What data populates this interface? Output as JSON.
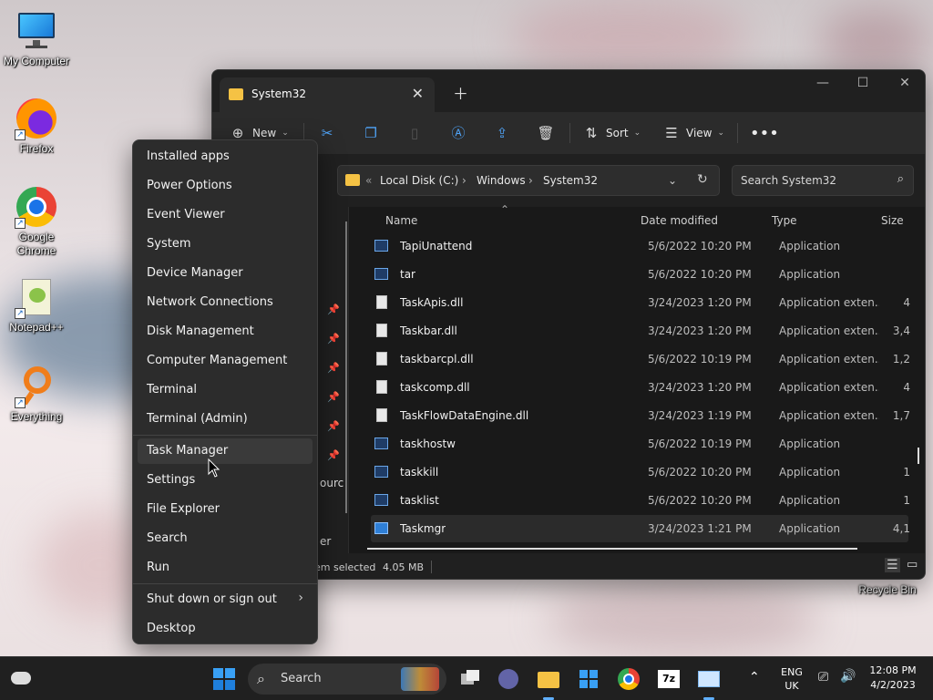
{
  "desktop": {
    "icons": [
      {
        "label": "My Computer"
      },
      {
        "label": "Firefox"
      },
      {
        "label": "Google Chrome"
      },
      {
        "label": "Notepad++"
      },
      {
        "label": "Everything"
      },
      {
        "label": "Recycle Bin"
      }
    ]
  },
  "explorer": {
    "tab_title": "System32",
    "toolbar": {
      "new_label": "New",
      "sort_label": "Sort",
      "view_label": "View"
    },
    "breadcrumb": [
      "Local Disk (C:)",
      "Windows",
      "System32"
    ],
    "search_placeholder": "Search System32",
    "columns": {
      "name": "Name",
      "date": "Date modified",
      "type": "Type",
      "size": "Size"
    },
    "files": [
      {
        "name": "TapiUnattend",
        "date": "5/6/2022 10:20 PM",
        "type": "Application",
        "size": ""
      },
      {
        "name": "tar",
        "date": "5/6/2022 10:20 PM",
        "type": "Application",
        "size": ""
      },
      {
        "name": "TaskApis.dll",
        "date": "3/24/2023 1:20 PM",
        "type": "Application exten...",
        "size": "4"
      },
      {
        "name": "Taskbar.dll",
        "date": "3/24/2023 1:20 PM",
        "type": "Application exten...",
        "size": "3,4"
      },
      {
        "name": "taskbarcpl.dll",
        "date": "5/6/2022 10:19 PM",
        "type": "Application exten...",
        "size": "1,2"
      },
      {
        "name": "taskcomp.dll",
        "date": "3/24/2023 1:20 PM",
        "type": "Application exten...",
        "size": "4"
      },
      {
        "name": "TaskFlowDataEngine.dll",
        "date": "3/24/2023 1:19 PM",
        "type": "Application exten...",
        "size": "1,7"
      },
      {
        "name": "taskhostw",
        "date": "5/6/2022 10:19 PM",
        "type": "Application",
        "size": ""
      },
      {
        "name": "taskkill",
        "date": "5/6/2022 10:20 PM",
        "type": "Application",
        "size": "1"
      },
      {
        "name": "tasklist",
        "date": "5/6/2022 10:20 PM",
        "type": "Application",
        "size": "1"
      },
      {
        "name": "Taskmgr",
        "date": "3/24/2023 1:21 PM",
        "type": "Application",
        "size": "4,1"
      }
    ],
    "nav_partial": [
      "ourc",
      "er"
    ],
    "status": {
      "selected": "em selected",
      "size": "4.05 MB"
    }
  },
  "context_menu": {
    "items": [
      {
        "label": "Installed apps"
      },
      {
        "label": "Power Options"
      },
      {
        "label": "Event Viewer"
      },
      {
        "label": "System"
      },
      {
        "label": "Device Manager"
      },
      {
        "label": "Network Connections"
      },
      {
        "label": "Disk Management"
      },
      {
        "label": "Computer Management"
      },
      {
        "label": "Terminal"
      },
      {
        "label": "Terminal (Admin)"
      },
      {
        "label": "Task Manager"
      },
      {
        "label": "Settings"
      },
      {
        "label": "File Explorer"
      },
      {
        "label": "Search"
      },
      {
        "label": "Run"
      },
      {
        "label": "Shut down or sign out"
      },
      {
        "label": "Desktop"
      }
    ]
  },
  "taskbar": {
    "search_label": "Search",
    "lang_top": "ENG",
    "lang_bottom": "UK",
    "time": "12:08 PM",
    "date": "4/2/2023",
    "zip_label": "7z"
  }
}
